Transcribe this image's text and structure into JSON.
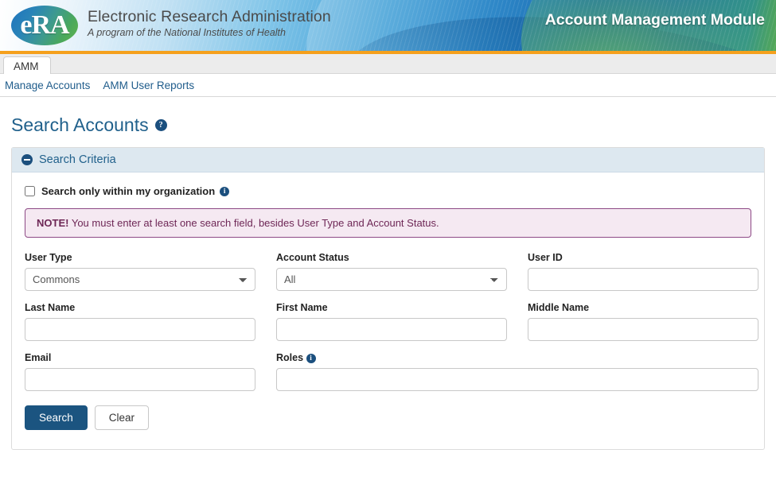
{
  "banner": {
    "logo_text": "eRA",
    "brand_title": "Electronic Research Administration",
    "brand_subtitle": "A program of the National Institutes of Health",
    "module_title": "Account Management Module",
    "accent_orange": "#f5a01c"
  },
  "tabs": [
    {
      "label": "AMM",
      "active": true
    }
  ],
  "subnav": {
    "items": [
      {
        "label": "Manage Accounts"
      },
      {
        "label": "AMM User Reports"
      }
    ]
  },
  "page": {
    "title": "Search Accounts",
    "help_icon": "question-mark-icon",
    "help_glyph": "?"
  },
  "panel": {
    "header": "Search Criteria",
    "collapse_icon": "minus-circle-icon"
  },
  "org_checkbox": {
    "label": "Search only within my organization",
    "checked": false,
    "info_icon": "info-icon",
    "info_glyph": "i"
  },
  "note": {
    "prefix": "NOTE!",
    "text": "You must enter at least one search field, besides User Type and Account Status.",
    "border_color": "#8d4a86",
    "background_color": "#f5e9f2",
    "text_color": "#6e2756"
  },
  "form": {
    "user_type": {
      "label": "User Type",
      "value": "Commons",
      "options": [
        "Commons"
      ]
    },
    "account_status": {
      "label": "Account Status",
      "value": "All",
      "options": [
        "All"
      ]
    },
    "user_id": {
      "label": "User ID",
      "value": "",
      "placeholder": ""
    },
    "last_name": {
      "label": "Last Name",
      "value": "",
      "placeholder": ""
    },
    "first_name": {
      "label": "First Name",
      "value": "",
      "placeholder": ""
    },
    "middle_name": {
      "label": "Middle Name",
      "value": "",
      "placeholder": ""
    },
    "email": {
      "label": "Email",
      "value": "",
      "placeholder": ""
    },
    "roles": {
      "label": "Roles",
      "value": "",
      "placeholder": "",
      "info_icon": "info-icon",
      "info_glyph": "i"
    }
  },
  "buttons": {
    "search": "Search",
    "clear": "Clear",
    "primary_color": "#1b5480"
  }
}
